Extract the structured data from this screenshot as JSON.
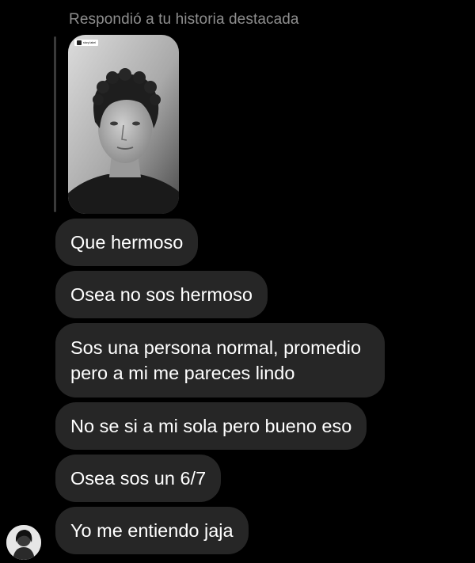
{
  "thread": {
    "reply_header": "Respondió a tu historia destacada",
    "story": {
      "label_text": "story label"
    },
    "messages": [
      {
        "text": "Que hermoso"
      },
      {
        "text": "Osea no sos hermoso"
      },
      {
        "text": "Sos una persona normal, promedio\npero a mi me pareces lindo"
      },
      {
        "text": "No se si a mi sola pero bueno eso"
      },
      {
        "text": "Osea sos un 6/7"
      },
      {
        "text": "Yo me entiendo jaja"
      }
    ],
    "sender_avatar_icon": "profile-avatar"
  },
  "colors": {
    "background": "#000000",
    "bubble": "#262626",
    "bubble_text": "#ffffff",
    "header_text": "#8e8e8e"
  }
}
